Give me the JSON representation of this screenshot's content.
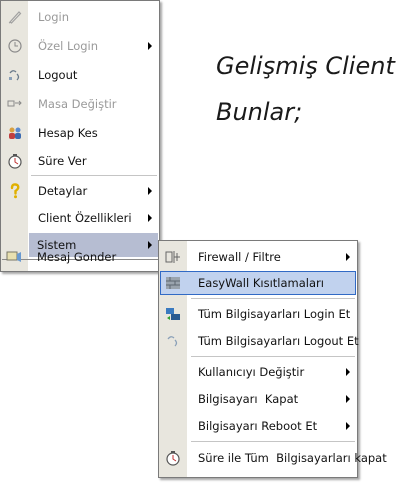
{
  "background_text": {
    "line1": "Gelişmiş Client",
    "line2": "Bunlar;"
  },
  "main_menu": {
    "items": [
      {
        "label": "Login",
        "icon": "pen-icon",
        "disabled": true
      },
      {
        "label": "Özel Login",
        "icon": "clock-outline-icon",
        "disabled": true,
        "submenu": true
      },
      {
        "label": "Logout",
        "icon": "logout-icon"
      },
      {
        "label": "Masa Değiştir",
        "icon": "swap-icon",
        "disabled": true
      },
      {
        "label": "Hesap Kes",
        "icon": "users-icon"
      },
      {
        "label": "Süre Ver",
        "icon": "timer-icon"
      },
      {
        "label": "Detaylar",
        "icon": "question-icon",
        "submenu": true
      },
      {
        "label": "Client Özellikleri",
        "submenu": true
      },
      {
        "label": "Sistem",
        "submenu": true,
        "selected": true
      },
      {
        "label": "Mesaj Gonder",
        "icon": "message-icon"
      }
    ]
  },
  "sub_menu": {
    "items": [
      {
        "label": "Firewall / Filtre",
        "icon": "firewall-icon",
        "submenu": true
      },
      {
        "label": "EasyWall Kısıtlamaları",
        "icon": "wall-icon",
        "highlighted": true
      },
      {
        "label": "Tüm Bilgisayarları Login Et",
        "icon": "computers-login-icon"
      },
      {
        "label": "Tüm Bilgisayarları Logout Et",
        "icon": "computers-logout-icon"
      },
      {
        "label": "Kullanıcıyı Değiştir",
        "submenu": true
      },
      {
        "label": "Bilgisayarı  Kapat",
        "submenu": true
      },
      {
        "label": "Bilgisayarı Reboot Et",
        "submenu": true
      },
      {
        "label": "Süre ile Tüm  Bilgisayarları kapat",
        "icon": "timer-icon"
      }
    ]
  },
  "colors": {
    "highlight": "#c1d2ee",
    "highlight_border": "#316ac5",
    "selected": "#b6bdd2",
    "icon_column": "#e8e6de"
  }
}
